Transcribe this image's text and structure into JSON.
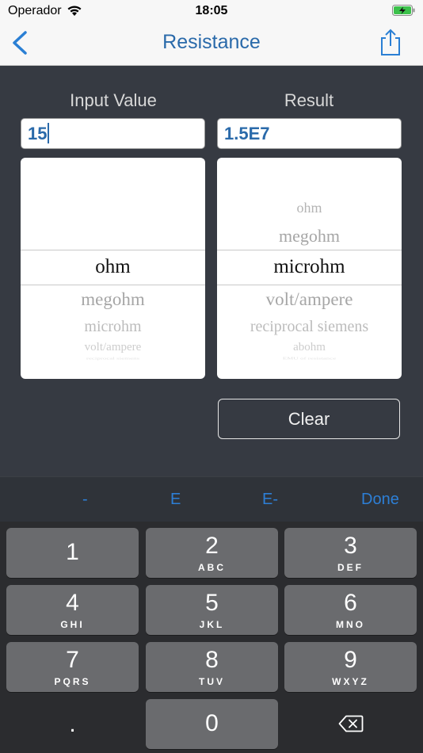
{
  "status_bar": {
    "carrier": "Operador",
    "time": "18:05"
  },
  "nav": {
    "title": "Resistance",
    "back_icon": "chevron-left-icon",
    "share_icon": "share-icon"
  },
  "colors": {
    "accent": "#2a6aaa",
    "panel": "#363a42",
    "keyboard": "#2b2c2f",
    "key": "#6a6b6e",
    "toolbar_blue": "#2d7fd6"
  },
  "input": {
    "label": "Input Value",
    "value": "15"
  },
  "result": {
    "label": "Result",
    "value": "1.5E7"
  },
  "input_picker": {
    "selected": "ohm",
    "after": [
      "megohm",
      "microhm",
      "volt/ampere",
      "reciprocal siemens"
    ]
  },
  "result_picker": {
    "before": [
      "ohm",
      "megohm"
    ],
    "selected": "microhm",
    "after": [
      "volt/ampere",
      "reciprocal siemens",
      "abohm",
      "EMU of resistance"
    ]
  },
  "clear_label": "Clear",
  "accessory": {
    "minus": "-",
    "e": "E",
    "e_minus": "E-",
    "done": "Done"
  },
  "keypad": {
    "keys": [
      {
        "digit": "1",
        "letters": ""
      },
      {
        "digit": "2",
        "letters": "ABC"
      },
      {
        "digit": "3",
        "letters": "DEF"
      },
      {
        "digit": "4",
        "letters": "GHI"
      },
      {
        "digit": "5",
        "letters": "JKL"
      },
      {
        "digit": "6",
        "letters": "MNO"
      },
      {
        "digit": "7",
        "letters": "PQRS"
      },
      {
        "digit": "8",
        "letters": "TUV"
      },
      {
        "digit": "9",
        "letters": "WXYZ"
      }
    ],
    "decimal": ".",
    "zero": "0",
    "delete_icon": "backspace-icon"
  }
}
